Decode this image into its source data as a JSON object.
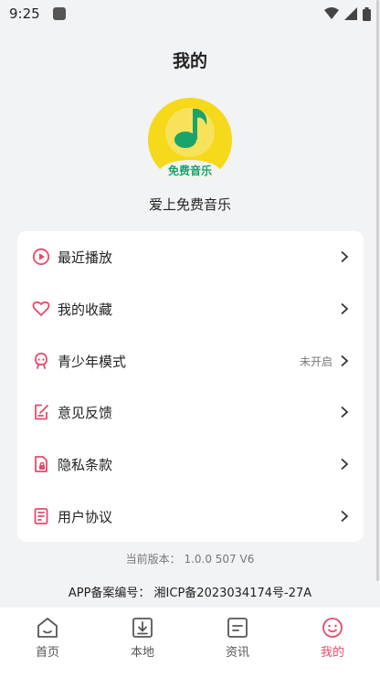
{
  "status_bar": {
    "time": "9:25"
  },
  "header": {
    "title": "我的"
  },
  "profile": {
    "logo_text": "免费音乐",
    "app_name": "爱上免费音乐"
  },
  "menu": {
    "items": [
      {
        "label": "最近播放",
        "icon": "play-circle-icon"
      },
      {
        "label": "我的收藏",
        "icon": "heart-icon"
      },
      {
        "label": "青少年模式",
        "icon": "teen-face-icon",
        "status": "未开启"
      },
      {
        "label": "意见反馈",
        "icon": "feedback-edit-icon"
      },
      {
        "label": "隐私条款",
        "icon": "privacy-doc-icon"
      },
      {
        "label": "用户协议",
        "icon": "agreement-doc-icon"
      }
    ]
  },
  "footer": {
    "version": "当前版本： 1.0.0 507 V6",
    "icp": "APP备案编号：  湘ICP备2023034174号-27A"
  },
  "tabs": [
    {
      "label": "首页",
      "icon": "home-icon"
    },
    {
      "label": "本地",
      "icon": "download-icon"
    },
    {
      "label": "资讯",
      "icon": "news-icon"
    },
    {
      "label": "我的",
      "icon": "smile-icon",
      "active": true
    }
  ],
  "colors": {
    "accent": "#e84a6a",
    "logo_yellow": "#f5d91a",
    "logo_green": "#1aa36b"
  }
}
